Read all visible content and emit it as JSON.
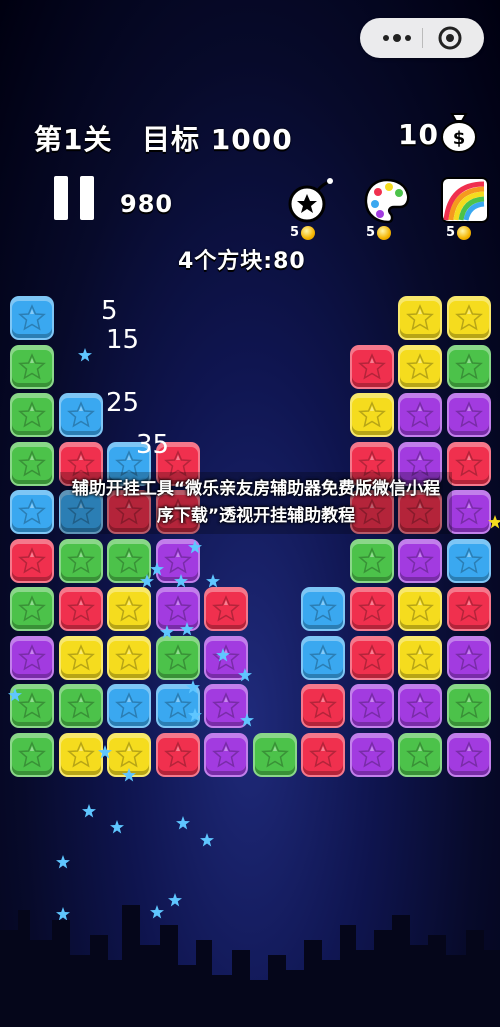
{
  "header": {
    "level_label": "第1关",
    "target_label": "目标 1000",
    "coins": "10",
    "score": "980",
    "blocks_info": "4个方块:80"
  },
  "tools": [
    {
      "name": "bomb",
      "cost": "5"
    },
    {
      "name": "palette",
      "cost": "5"
    },
    {
      "name": "rainbow",
      "cost": "5"
    }
  ],
  "score_popups": [
    "5",
    "15",
    "25",
    "35"
  ],
  "overlay_caption": "辅助开挂工具“微乐亲友房辅助器免费版微信小程序下载”透视开挂辅助教程",
  "colors": {
    "blue": "#3aa8f0",
    "green": "#4cc24a",
    "red": "#f0304e",
    "yellow": "#f5dc1e",
    "purple": "#a23be0"
  },
  "board": {
    "cols": 10,
    "rows": 10,
    "cells": [
      [
        "B",
        "",
        "",
        "",
        "",
        "",
        "",
        "",
        "Y",
        "Y"
      ],
      [
        "G",
        "",
        "",
        "",
        "",
        "",
        "",
        "R",
        "Y",
        "G"
      ],
      [
        "G",
        "B",
        "",
        "",
        "",
        "",
        "",
        "Y",
        "P",
        "P"
      ],
      [
        "G",
        "R",
        "B",
        "R",
        "",
        "",
        "",
        "R",
        "P",
        "R"
      ],
      [
        "B",
        "B",
        "R",
        "R",
        "",
        "",
        "",
        "R",
        "R",
        "P"
      ],
      [
        "R",
        "G",
        "G",
        "P",
        "",
        "",
        "",
        "G",
        "P",
        "B"
      ],
      [
        "G",
        "R",
        "Y",
        "P",
        "R",
        "",
        "B",
        "R",
        "Y",
        "R"
      ],
      [
        "P",
        "Y",
        "Y",
        "G",
        "P",
        "",
        "B",
        "R",
        "Y",
        "P"
      ],
      [
        "G",
        "G",
        "B",
        "B",
        "P",
        "",
        "R",
        "P",
        "P",
        "G"
      ],
      [
        "G",
        "Y",
        "Y",
        "R",
        "P",
        "G",
        "R",
        "P",
        "G",
        "P"
      ]
    ]
  }
}
